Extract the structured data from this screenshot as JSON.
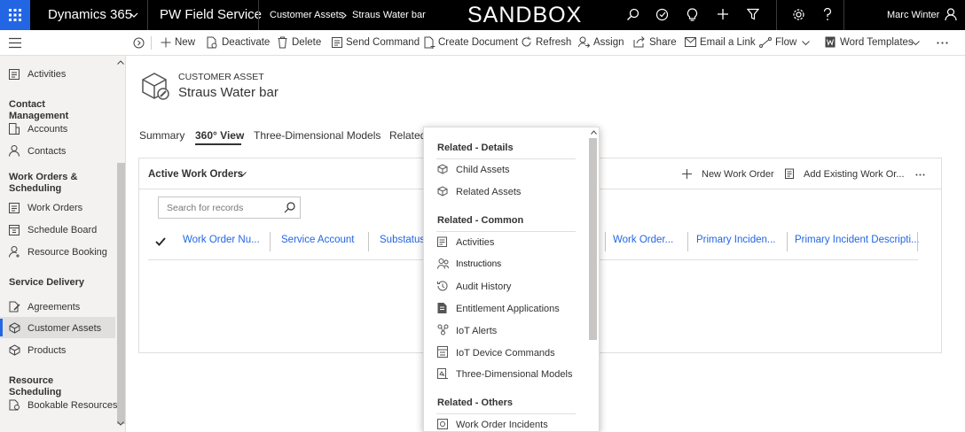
{
  "topbar": {
    "app_name": "Dynamics 365",
    "app_title": "PW Field Service",
    "breadcrumb_entity": "Customer Assets",
    "breadcrumb_record": "Straus Water bar",
    "env_label": "SANDBOX",
    "user_name": "Marc Winter"
  },
  "toolbar": {
    "new": "New",
    "deactivate": "Deactivate",
    "delete": "Delete",
    "send_command": "Send Command",
    "create_document": "Create Document",
    "refresh": "Refresh",
    "assign": "Assign",
    "share": "Share",
    "email_link": "Email a Link",
    "flow": "Flow",
    "word_templates": "Word Templates"
  },
  "sidebar": {
    "activities": "Activities",
    "group_contact": "Contact Management",
    "accounts": "Accounts",
    "contacts": "Contacts",
    "group_work": "Work Orders & Scheduling",
    "work_orders": "Work Orders",
    "schedule_board": "Schedule Board",
    "resource_booking": "Resource Booking",
    "group_service": "Service Delivery",
    "agreements": "Agreements",
    "customer_assets": "Customer Assets",
    "products": "Products",
    "group_resource": "Resource Scheduling",
    "bookable_resources": "Bookable Resources"
  },
  "header": {
    "entity_type": "CUSTOMER ASSET",
    "record_name": "Straus Water bar"
  },
  "tabs": [
    "Summary",
    "360° View",
    "Three-Dimensional Models",
    "Related"
  ],
  "subgrid": {
    "title": "Active Work Orders",
    "new_button": "New Work Order",
    "add_existing": "Add Existing Work Or...",
    "search_placeholder": "Search for records",
    "columns": [
      "Work Order Nu...",
      "Service Account",
      "Substatus",
      "Work Order...",
      "Primary Inciden...",
      "Primary Incident Descripti..."
    ]
  },
  "related_menu": {
    "details_header": "Related - Details",
    "child_assets": "Child Assets",
    "related_assets": "Related Assets",
    "common_header": "Related - Common",
    "activities": "Activities",
    "instructions": "Instructions",
    "audit_history": "Audit History",
    "entitlement_applications": "Entitlement Applications",
    "iot_alerts": "IoT Alerts",
    "iot_device_commands": "IoT Device Commands",
    "three_d_models": "Three-Dimensional Models",
    "others_header": "Related - Others",
    "work_order_incidents": "Work Order Incidents"
  },
  "colors": {
    "accent": "#2266e3",
    "topbar": "#000000"
  }
}
